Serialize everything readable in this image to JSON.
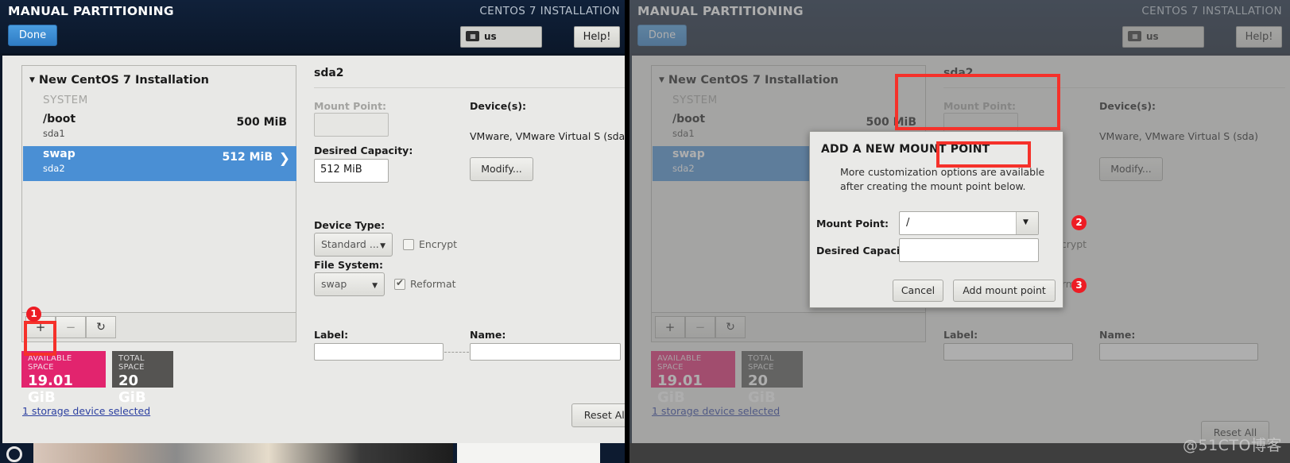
{
  "header": {
    "title": "MANUAL PARTITIONING",
    "product": "CENTOS 7 INSTALLATION",
    "done_label": "Done",
    "keyboard_layout": "us",
    "keyboard_icon": "keyboard-icon",
    "help_label": "Help!"
  },
  "tree": {
    "group_title": "New CentOS 7 Installation",
    "section_label": "SYSTEM",
    "partitions": [
      {
        "name": "/boot",
        "device": "sda1",
        "size": "500 MiB",
        "selected": false
      },
      {
        "name": "swap",
        "device": "sda2",
        "size": "512 MiB",
        "selected": true
      }
    ],
    "toolbar": {
      "add_label": "+",
      "remove_label": "−",
      "refresh_label": "↻",
      "add_icon": "plus-icon",
      "remove_icon": "minus-icon",
      "refresh_icon": "refresh-icon"
    }
  },
  "space": {
    "available_caption": "AVAILABLE SPACE",
    "available_value": "19.01 GiB",
    "total_caption": "TOTAL SPACE",
    "total_value": "20 GiB",
    "available_color": "#e2246e",
    "total_color": "#555452",
    "storage_link": "1 storage device selected"
  },
  "detail": {
    "device_title": "sda2",
    "mount_point_label": "Mount Point:",
    "mount_point_value": "",
    "desired_capacity_label": "Desired Capacity:",
    "desired_capacity_value": "512 MiB",
    "device_type_label": "Device Type:",
    "device_type_value": "Standard ...",
    "encrypt_label": "Encrypt",
    "encrypt_checked": false,
    "file_system_label": "File System:",
    "file_system_value": "swap",
    "reformat_label": "Reformat",
    "reformat_checked": true,
    "label_label": "Label:",
    "label_value": "",
    "name_label": "Name:",
    "name_value": "",
    "devices_label": "Device(s):",
    "devices_value": "VMware, VMware Virtual S (sda)",
    "modify_label": "Modify...",
    "reset_label": "Reset All"
  },
  "dialog": {
    "title": "ADD A NEW MOUNT POINT",
    "subtitle": "More customization options are available after creating the mount point below.",
    "mount_point_label": "Mount Point:",
    "mount_point_value": "/",
    "desired_capacity_label": "Desired Capacity:",
    "desired_capacity_value": "",
    "cancel_label": "Cancel",
    "confirm_label": "Add mount point",
    "dropdown_icon": "chevron-down-icon"
  },
  "annotations": {
    "step1": "1",
    "step2": "2",
    "step3": "3",
    "color": "#ed1c24"
  },
  "watermark": "@51CTO博客"
}
